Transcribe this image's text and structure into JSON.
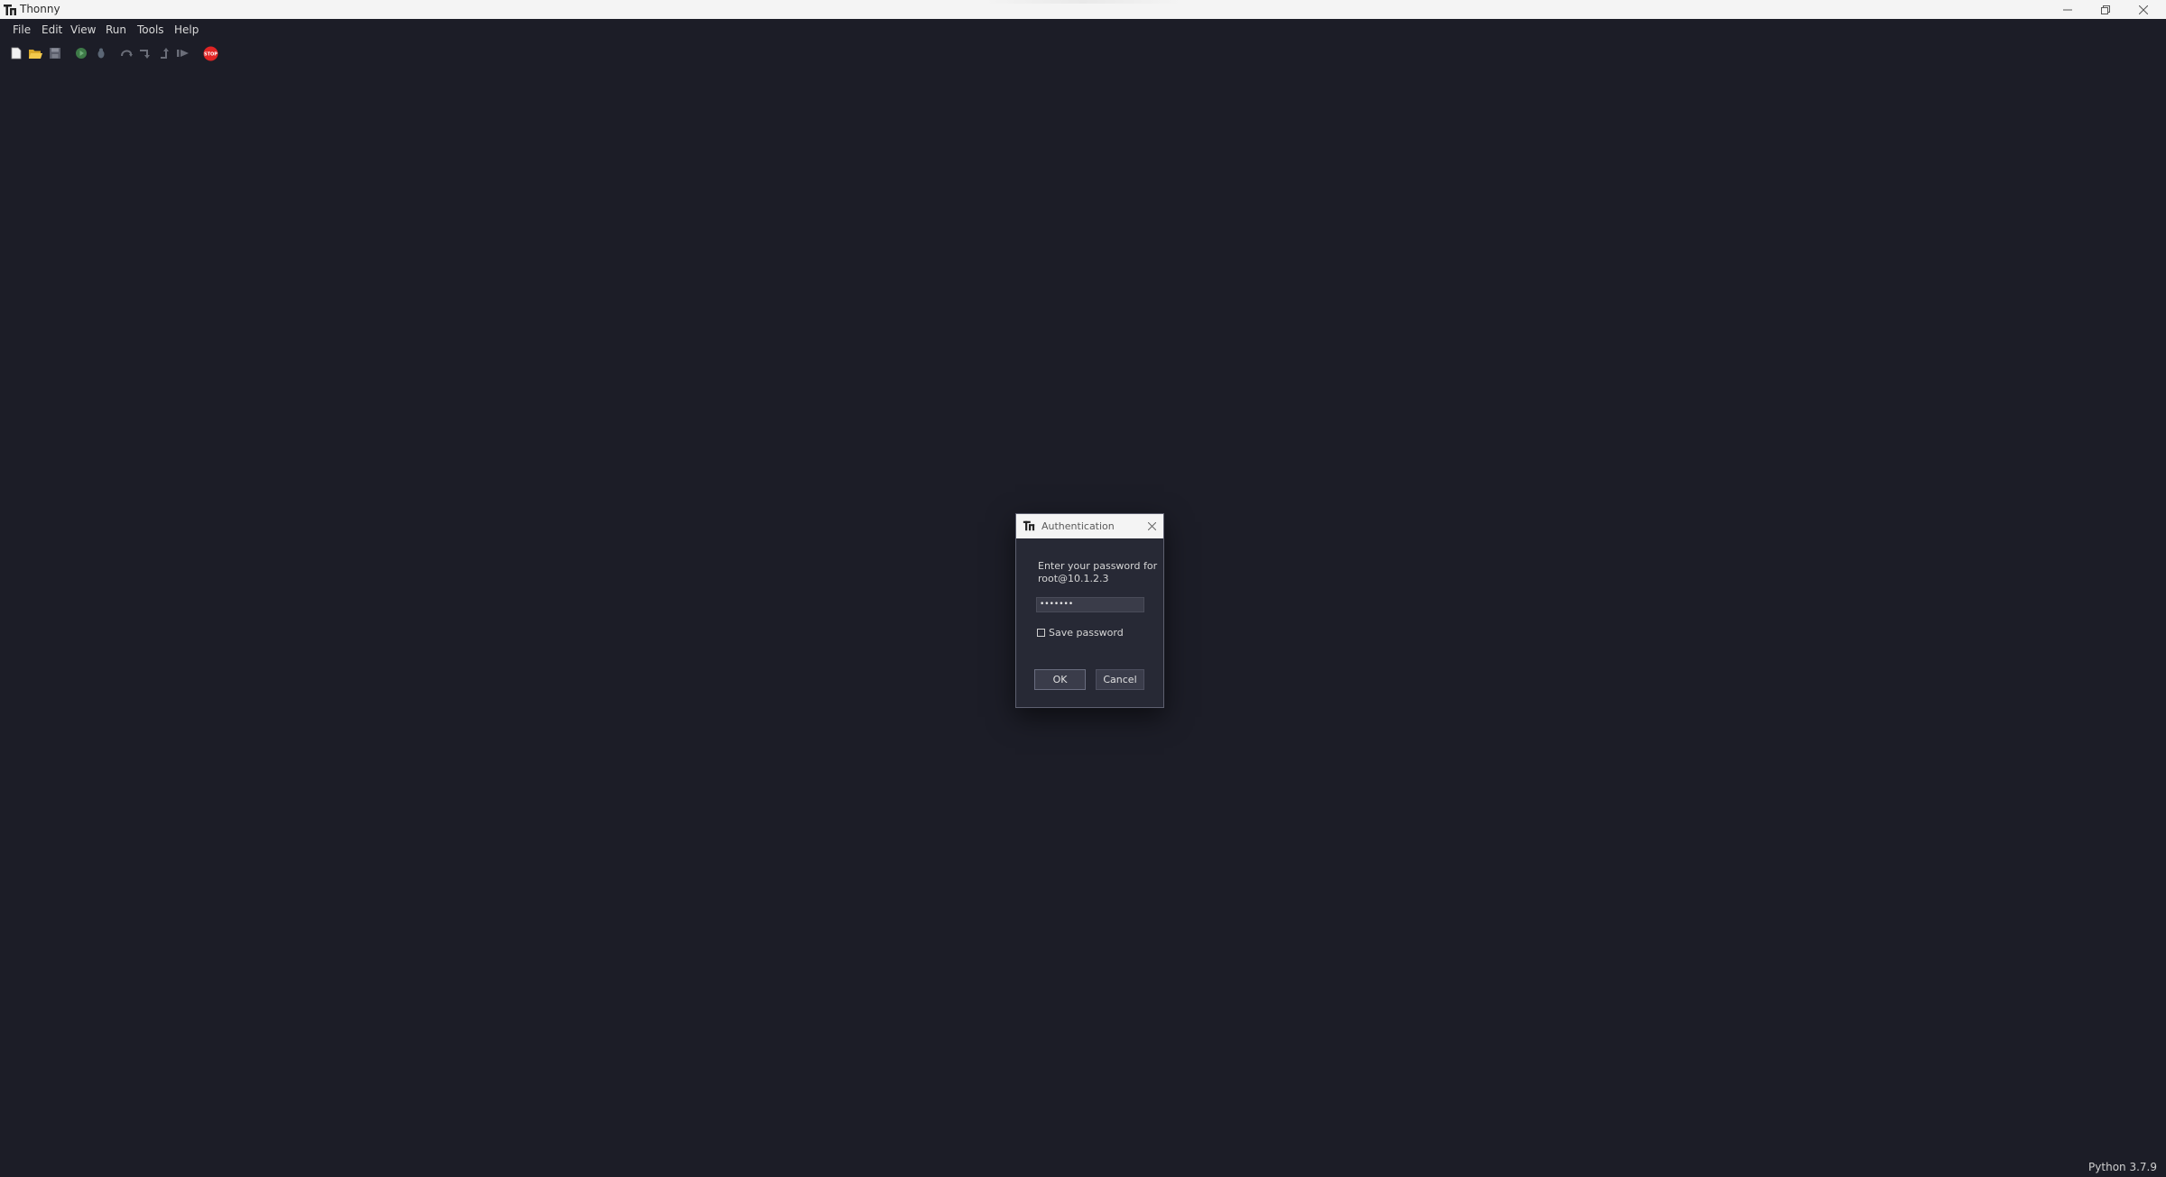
{
  "window": {
    "title": "Thonny"
  },
  "menu": {
    "items": [
      "File",
      "Edit",
      "View",
      "Run",
      "Tools",
      "Help"
    ]
  },
  "toolbar": {
    "icons": [
      "new-file-icon",
      "open-file-icon",
      "save-icon",
      "run-icon",
      "debug-icon",
      "step-over-icon",
      "step-into-icon",
      "step-out-icon",
      "resume-icon",
      "stop-icon"
    ],
    "stop_color": "#e02424",
    "stop_label": "STOP"
  },
  "status": {
    "interpreter": "Python 3.7.9"
  },
  "dialog": {
    "title": "Authentication",
    "prompt_line1": "Enter your password for",
    "prompt_line2": "root@10.1.2.3",
    "password_value": "•••••••",
    "save_password_label": "Save password",
    "save_password_checked": false,
    "ok_label": "OK",
    "cancel_label": "Cancel"
  },
  "colors": {
    "background": "#1c1d27",
    "dialog_background": "#272935",
    "titlebar": "#f4f4f4"
  }
}
